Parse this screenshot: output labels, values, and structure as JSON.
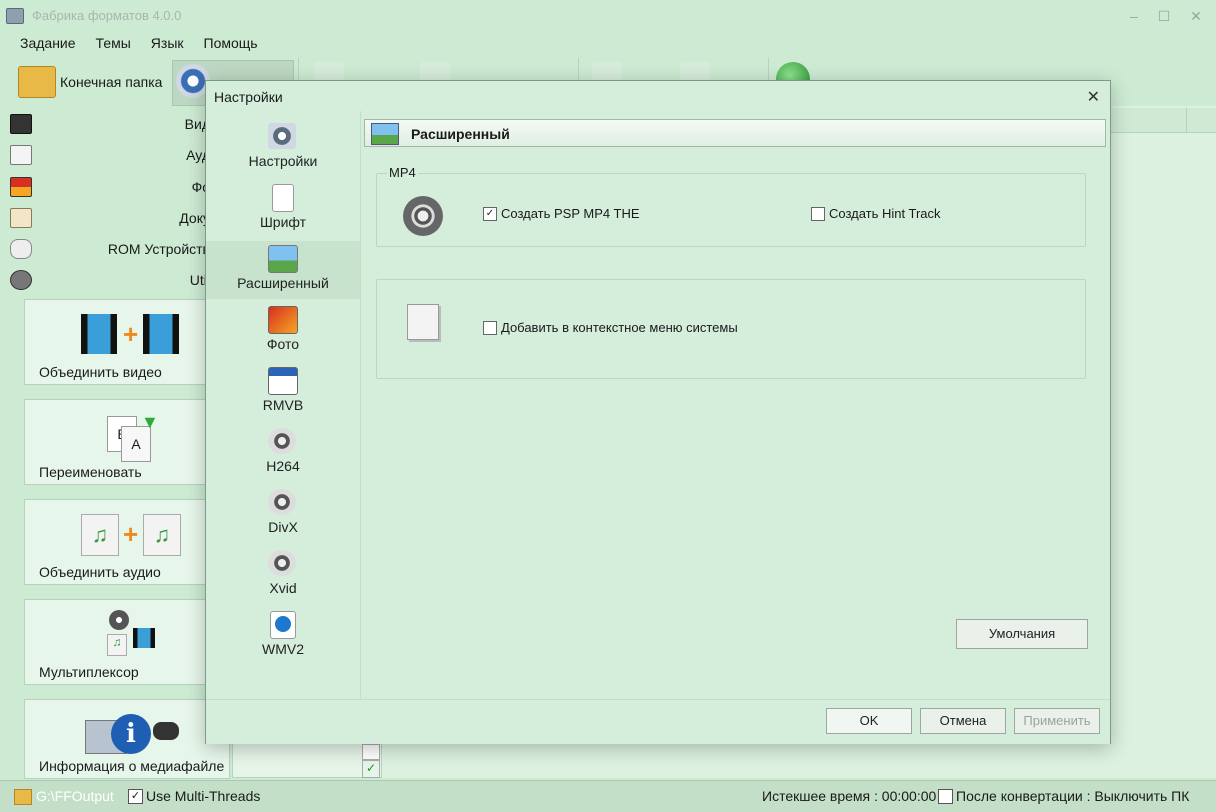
{
  "window": {
    "title": "Фабрика форматов 4.0.0",
    "min": "–",
    "max": "☐",
    "close": "✕"
  },
  "menu": [
    "Задание",
    "Темы",
    "Язык",
    "Помощь"
  ],
  "toolbar": {
    "output_folder": "Конечная папка"
  },
  "categories": [
    "Вид",
    "Ауд",
    "Фо",
    "Доку",
    "ROM Устройств",
    "Util"
  ],
  "actions": [
    "Объединить видео",
    "Переименовать",
    "Объединить аудио",
    "Мультиплексор",
    "Информация о медиафайле"
  ],
  "status": {
    "folder": "G:\\FFOutput",
    "multithreads": "Use Multi-Threads",
    "elapsed": "Истекшее время : 00:00:00",
    "after": "После конвертации : Выключить ПК"
  },
  "dialog": {
    "title": "Настройки",
    "close": "✕",
    "nav": [
      "Настройки",
      "Шрифт",
      "Расширенный",
      "Фото",
      "RMVB",
      "H264",
      "DivX",
      "Xvid",
      "WMV2"
    ],
    "section_title": "Расширенный",
    "mp4": {
      "legend": "MP4",
      "psp_label": "Создать PSP MP4 THE",
      "psp_checked": true,
      "hint_label": "Создать Hint Track",
      "hint_checked": false
    },
    "context": {
      "label": "Добавить в контекстное меню системы",
      "checked": false
    },
    "defaults_button": "Умолчания",
    "ok": "OK",
    "cancel": "Отмена",
    "apply": "Применить"
  },
  "colors": {
    "background": "#cdebd3",
    "dialog": "#d5eedb",
    "accent": "#3b6fb5"
  }
}
